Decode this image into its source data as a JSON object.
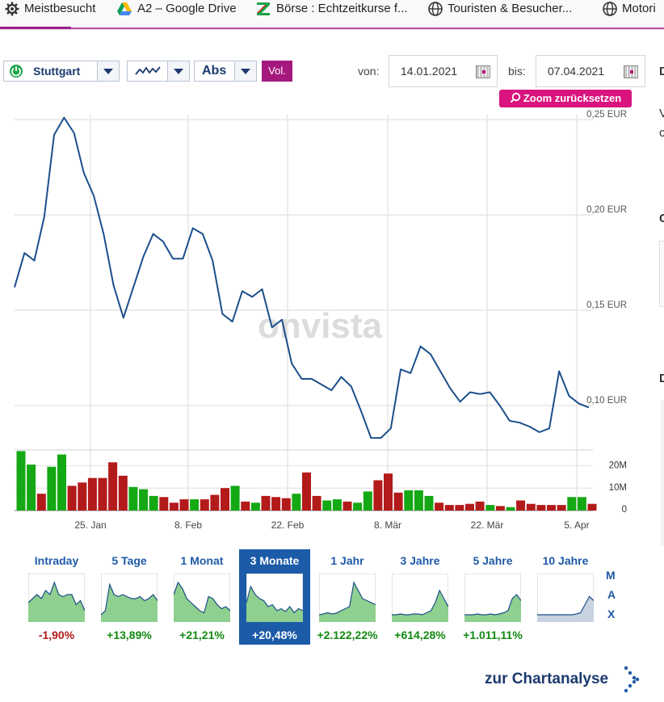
{
  "bookmarks": [
    {
      "label": "Meistbesucht",
      "icon": "gear-icon"
    },
    {
      "label": "A2 – Google Drive",
      "icon": "google-drive-icon"
    },
    {
      "label": "Börse : Echtzeitkurse f...",
      "icon": "boerse-icon"
    },
    {
      "label": "Touristen & Besucher...",
      "icon": "globe-icon"
    },
    {
      "label": "Motori",
      "icon": "globe-icon"
    }
  ],
  "controls": {
    "exchange": "Stuttgart",
    "chart_type_icon": "line-chart-icon",
    "scale": "Abs",
    "volume_button": "Vol.",
    "from_label": "von:",
    "from_date": "14.01.2021",
    "to_label": "bis:",
    "to_date": "07.04.2021",
    "zoom_reset": "Zoom zurücksetzen"
  },
  "watermark": "onvista",
  "colors": {
    "line": "#1c4f8c",
    "vol_up": "#15a815",
    "vol_down": "#b31a1a",
    "accent": "#a5197f",
    "pink": "#d9147e",
    "active": "#1c5ba8"
  },
  "chart_data": {
    "type": "line",
    "x_ticks": [
      "25. Jan",
      "8. Feb",
      "22. Feb",
      "8. Mär",
      "22. Mär",
      "5. Apr"
    ],
    "y_ticks": [
      "0,25 EUR",
      "0,20 EUR",
      "0,15 EUR",
      "0,10 EUR"
    ],
    "ylim": [
      0.07,
      0.25
    ],
    "series": [
      {
        "values": [
          0.162,
          0.18,
          0.176,
          0.199,
          0.242,
          0.251,
          0.243,
          0.222,
          0.21,
          0.19,
          0.163,
          0.146,
          0.162,
          0.178,
          0.19,
          0.186,
          0.177,
          0.177,
          0.193,
          0.19,
          0.176,
          0.148,
          0.144,
          0.16,
          0.157,
          0.161,
          0.141,
          0.145,
          0.122,
          0.114,
          0.114,
          0.111,
          0.108,
          0.115,
          0.11,
          0.097,
          0.083,
          0.083,
          0.088,
          0.119,
          0.117,
          0.131,
          0.127,
          0.118,
          0.109,
          0.102,
          0.107,
          0.106,
          0.107,
          0.1,
          0.092,
          0.091,
          0.089,
          0.086,
          0.088,
          0.118,
          0.105,
          0.101,
          0.099
        ]
      }
    ],
    "volume": {
      "y_ticks": [
        "20M",
        "10M",
        "0"
      ],
      "ylim": [
        0,
        27
      ],
      "values": [
        26.5,
        20.5,
        7.5,
        19.5,
        25,
        11,
        12.5,
        14.5,
        14.5,
        21.5,
        15.5,
        10.5,
        9.5,
        6.5,
        6,
        3.5,
        5,
        5,
        5,
        7,
        10,
        11,
        4,
        3.5,
        6.5,
        6,
        5.5,
        7.5,
        17,
        6.5,
        4.5,
        5,
        4,
        3.5,
        8.5,
        13.5,
        16.5,
        8,
        9,
        9,
        6.5,
        3.5,
        2.5,
        2.5,
        3,
        4,
        2.5,
        2,
        1.5,
        4.5,
        3,
        2.5,
        2.5,
        2.5,
        6,
        6,
        3
      ],
      "direction": [
        "u",
        "u",
        "d",
        "u",
        "u",
        "d",
        "d",
        "d",
        "d",
        "d",
        "d",
        "u",
        "u",
        "u",
        "d",
        "d",
        "d",
        "u",
        "d",
        "d",
        "d",
        "u",
        "d",
        "u",
        "d",
        "d",
        "d",
        "u",
        "d",
        "d",
        "u",
        "u",
        "d",
        "u",
        "u",
        "d",
        "d",
        "d",
        "u",
        "u",
        "u",
        "d",
        "d",
        "d",
        "d",
        "d",
        "u",
        "d",
        "u",
        "d",
        "d",
        "d",
        "d",
        "d",
        "u",
        "u",
        "d"
      ]
    }
  },
  "periods": [
    {
      "label": "Intraday",
      "pct": "-1,90%",
      "pos": false
    },
    {
      "label": "5 Tage",
      "pct": "+13,89%",
      "pos": true
    },
    {
      "label": "1 Monat",
      "pct": "+21,21%",
      "pos": true
    },
    {
      "label": "3 Monate",
      "pct": "+20,48%",
      "pos": true,
      "active": true
    },
    {
      "label": "1 Jahr",
      "pct": "+2.122,22%",
      "pos": true
    },
    {
      "label": "3 Jahre",
      "pct": "+614,28%",
      "pos": true
    },
    {
      "label": "5 Jahre",
      "pct": "+1.011,11%",
      "pos": true
    },
    {
      "label": "10 Jahre",
      "pct": "",
      "pos": true
    }
  ],
  "max_letters": [
    "M",
    "A",
    "X"
  ],
  "chart_analysis_link": "zur Chartanalyse",
  "right_fragments": [
    "D",
    "V",
    "c",
    "C",
    "D"
  ]
}
